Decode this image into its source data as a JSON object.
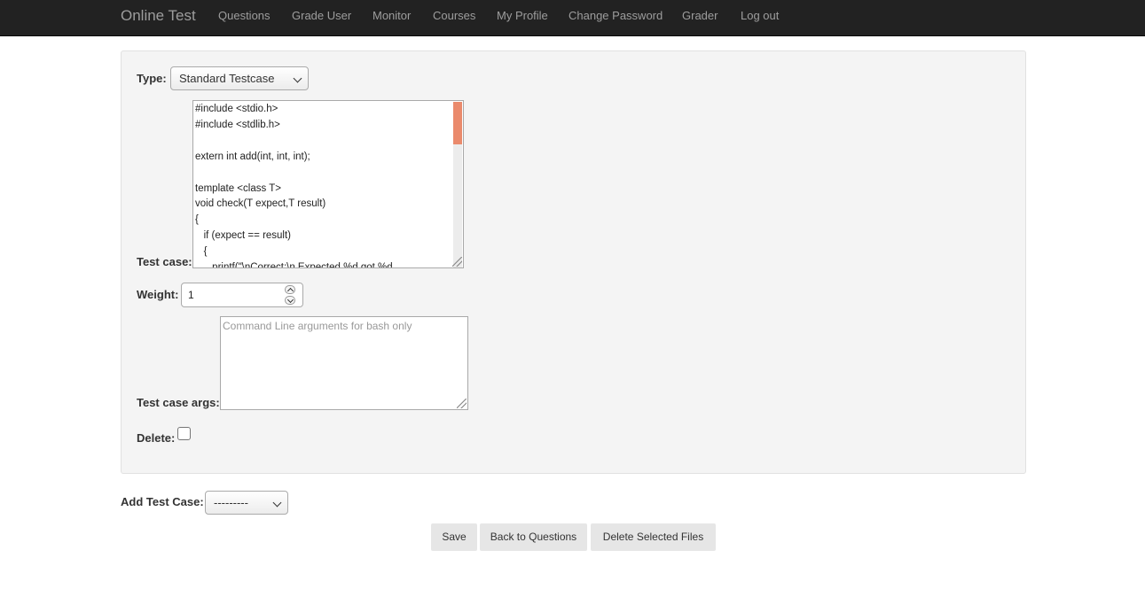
{
  "nav": {
    "brand": "Online Test",
    "links": [
      "Questions",
      "Grade User",
      "Monitor",
      "Courses",
      "My Profile",
      "Change Password",
      "Grader",
      "Log out"
    ]
  },
  "form": {
    "type_label": "Type:",
    "type_value": "Standard Testcase",
    "test_case_label": "Test case:",
    "code_lines": [
      "#include <stdio.h>",
      "#include <stdlib.h>",
      "",
      "extern int add(int, int, int);",
      "",
      "template <class T>",
      "void check(T expect,T result)",
      "{",
      "   if (expect == result)",
      "   {",
      "      printf(\"\\nCorrect:\\n Expected %d got %d"
    ],
    "weight_label": "Weight:",
    "weight_value": "1",
    "args_label": "Test case args:",
    "args_placeholder": "Command Line arguments for bash only",
    "delete_label": "Delete:"
  },
  "add_test_case": {
    "label": "Add Test Case:",
    "value": "---------"
  },
  "buttons": {
    "save": "Save",
    "back": "Back to Questions",
    "delete_files": "Delete Selected Files"
  }
}
